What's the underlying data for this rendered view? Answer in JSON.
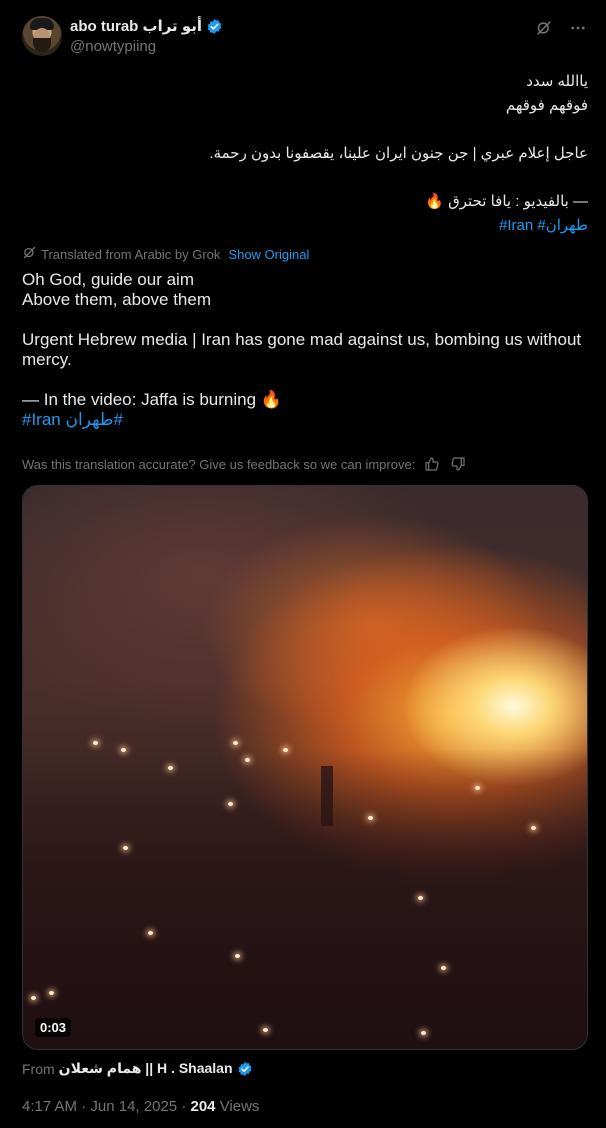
{
  "author": {
    "display_name": "abo turab أبو تراب",
    "handle": "@nowtypiing"
  },
  "post": {
    "arabic_lines": [
      "ياالله سدد",
      "فوقهم فوقهم",
      "",
      "عاجل إعلام عبري | جن جنون ايران علينا، يقصفونا بدون رحمة.",
      "",
      "— بالفيديو : يافا تحترق 🔥"
    ],
    "arabic_hashtags": "#Iran #طهران",
    "translation_note": "Translated from Arabic by Grok",
    "show_original": "Show Original",
    "english_lines": [
      "Oh God, guide our aim",
      "Above them, above them",
      "",
      "Urgent Hebrew media | Iran has gone mad against us, bombing us without mercy.",
      "",
      "— In the video: Jaffa is burning 🔥"
    ],
    "english_hashtags": "#Iran طهران#",
    "feedback_prompt": "Was this translation accurate? Give us feedback so we can improve:"
  },
  "video": {
    "duration": "0:03"
  },
  "source": {
    "prefix": "From",
    "name": "همام شعلان || H . Shaalan"
  },
  "meta": {
    "time": "4:17 AM",
    "date": "Jun 14, 2025",
    "views_count": "204",
    "views_label": "Views"
  },
  "colors": {
    "background": "#000000",
    "text": "#e7e9ea",
    "muted": "#71767b",
    "accent": "#1d9bf0"
  },
  "icons": {
    "verified": "verified-badge-icon",
    "grok": "grok-icon",
    "more": "more-icon",
    "translate": "translate-icon",
    "thumbs_up": "thumbs-up-icon",
    "thumbs_down": "thumbs-down-icon"
  }
}
